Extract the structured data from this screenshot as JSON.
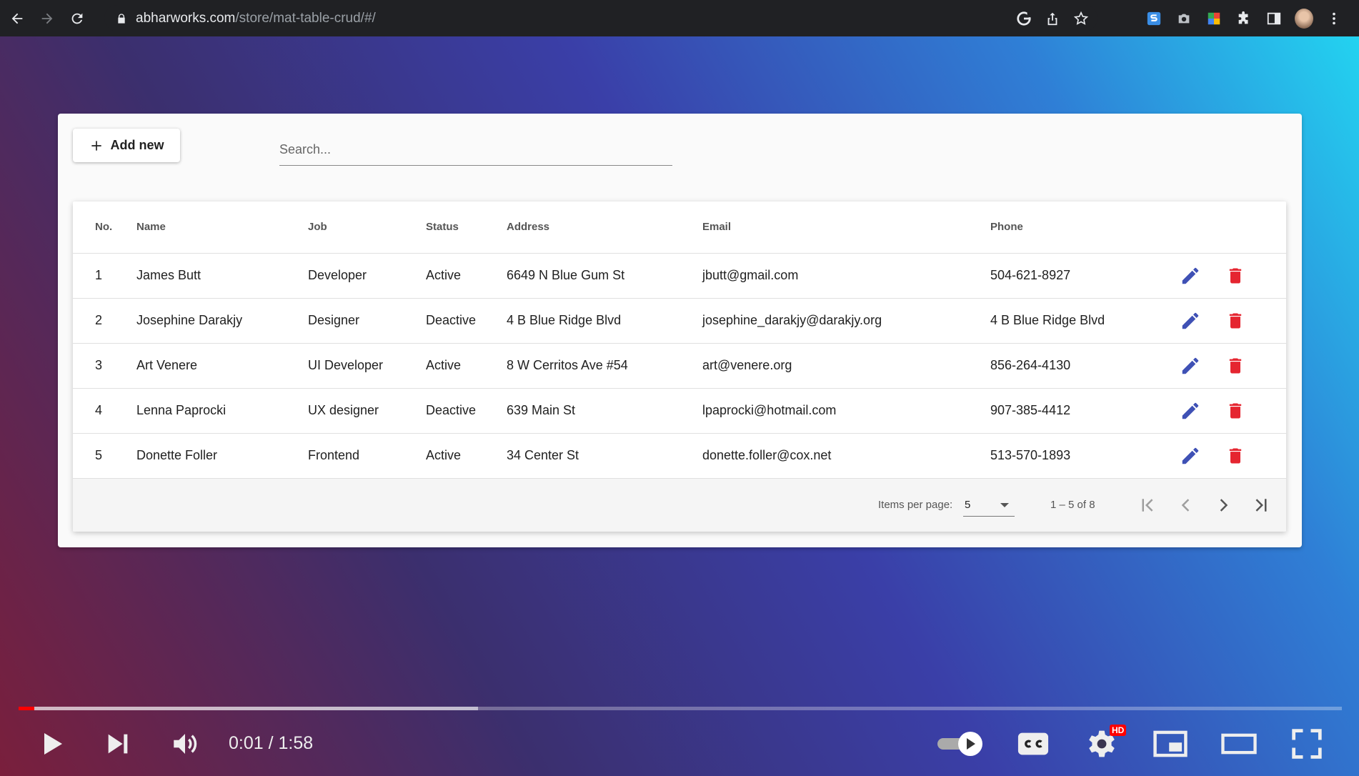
{
  "browser": {
    "url_host": "abharworks.com",
    "url_path": "/store/mat-table-crud/#/"
  },
  "toolbar": {
    "add_label": "Add new",
    "search_placeholder": "Search..."
  },
  "table": {
    "columns": [
      "No.",
      "Name",
      "Job",
      "Status",
      "Address",
      "Email",
      "Phone"
    ],
    "rows": [
      {
        "no": "1",
        "name": "James Butt",
        "job": "Developer",
        "status": "Active",
        "address": "6649 N Blue Gum St",
        "email": "jbutt@gmail.com",
        "phone": "504-621-8927"
      },
      {
        "no": "2",
        "name": "Josephine Darakjy",
        "job": "Designer",
        "status": "Deactive",
        "address": "4 B Blue Ridge Blvd",
        "email": "josephine_darakjy@darakjy.org",
        "phone": "4 B Blue Ridge Blvd"
      },
      {
        "no": "3",
        "name": "Art Venere",
        "job": "UI Developer",
        "status": "Active",
        "address": "8 W Cerritos Ave #54",
        "email": "art@venere.org",
        "phone": "856-264-4130"
      },
      {
        "no": "4",
        "name": "Lenna Paprocki",
        "job": "UX designer",
        "status": "Deactive",
        "address": "639 Main St",
        "email": "lpaprocki@hotmail.com",
        "phone": "907-385-4412"
      },
      {
        "no": "5",
        "name": "Donette Foller",
        "job": "Frontend",
        "status": "Active",
        "address": "34 Center St",
        "email": "donette.foller@cox.net",
        "phone": "513-570-1893"
      }
    ]
  },
  "paginator": {
    "items_per_page_label": "Items per page:",
    "page_size": "5",
    "range_label": "1 – 5 of 8"
  },
  "colors": {
    "edit_icon": "#3f51b5",
    "delete_icon": "#e52530",
    "progress_played": "#ff0000"
  },
  "video": {
    "time_label": "0:01 / 1:58",
    "hd_badge": "HD",
    "played_fraction": 0.012,
    "buffered_fraction": 0.347
  }
}
